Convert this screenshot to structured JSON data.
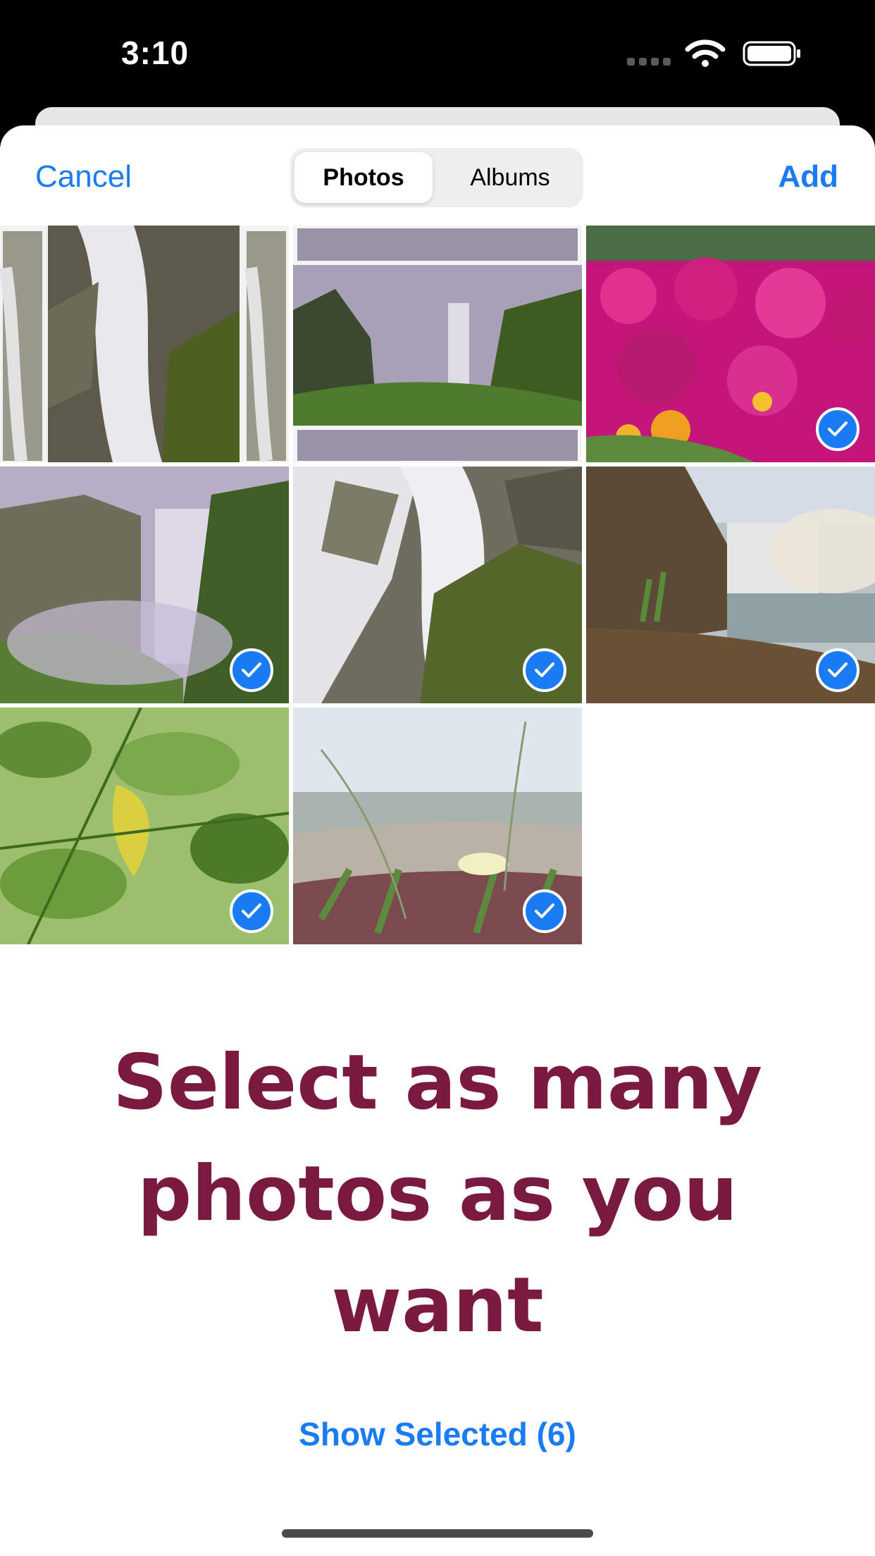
{
  "status_bar": {
    "time": "3:10"
  },
  "nav": {
    "cancel": "Cancel",
    "add": "Add",
    "tabs": [
      "Photos",
      "Albums"
    ],
    "active_tab": "Photos"
  },
  "photos": [
    {
      "subject": "waterfall-closeup-collage",
      "selected": false
    },
    {
      "subject": "waterfall-valley-collage",
      "selected": false
    },
    {
      "subject": "pink-flowers",
      "selected": true
    },
    {
      "subject": "misty-waterfall",
      "selected": true
    },
    {
      "subject": "waterfall-rocks",
      "selected": true
    },
    {
      "subject": "coastal-waterfall",
      "selected": true
    },
    {
      "subject": "green-leaves",
      "selected": true
    },
    {
      "subject": "beach-grass-flower",
      "selected": true
    }
  ],
  "promo": {
    "line1": "Select as many",
    "line2": "photos as you",
    "line3": "want"
  },
  "show_selected": "Show Selected (6)",
  "colors": {
    "accent": "#1a7cf5",
    "promo": "#7a1a40",
    "sheet": "#ffffff"
  }
}
